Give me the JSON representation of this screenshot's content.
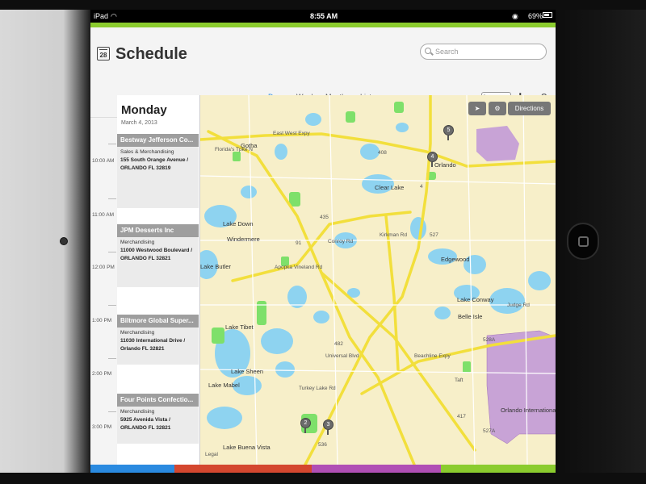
{
  "status_bar": {
    "device": "iPad",
    "time": "8:55 AM",
    "battery": "69%"
  },
  "header": {
    "app_title": "Schedule",
    "calendar_day": "28",
    "search_placeholder": "Search",
    "today_label": "Today",
    "add_label": "+",
    "help_label": "?"
  },
  "tabs": [
    {
      "label": "Day",
      "active": true
    },
    {
      "label": "Week",
      "active": false
    },
    {
      "label": "Month",
      "active": false
    },
    {
      "label": "List",
      "active": false
    }
  ],
  "day_view": {
    "day_name": "Monday",
    "date": "March 4, 2013",
    "time_labels": [
      "10:00 AM",
      "11:00 AM",
      "12:00 PM",
      "1:00 PM",
      "2:00 PM",
      "3:00 PM"
    ],
    "events": [
      {
        "name": "Bestway Jefferson Co...",
        "category": "Sales & Merchandising",
        "address": "155 South Orange Avenue / ORLANDO FL 32819"
      },
      {
        "name": "JPM Desserts Inc",
        "category": "Merchandising",
        "address": "11000 Westwood Boulevard / ORLANDO FL 32821"
      },
      {
        "name": "Biltmore Global Super...",
        "category": "Merchandising",
        "address": "11030 International Drive / Orlando FL 32821"
      },
      {
        "name": "Four Points Confectio...",
        "category": "Merchandising",
        "address": "5925 Avenida Vista / ORLANDO FL 32821"
      }
    ]
  },
  "map": {
    "directions_label": "Directions",
    "place_labels": [
      "Gotha",
      "Orlando",
      "Clear Lake",
      "Lake Down",
      "Windermere",
      "Edgewood",
      "Lake Conway",
      "Judge Rd",
      "Belle Isle",
      "Lake Tibet",
      "Lake Sheen",
      "Lake Mabel",
      "Lake Butler",
      "Universal Blvd",
      "Beachline Expy",
      "Orlando International Airport",
      "Lake Buena Vista",
      "East West Expy",
      "Florida's Tpke N",
      "Conroy Rd",
      "Kirkman Rd",
      "Turkey Lake Rd",
      "Apopka Vineland Rd",
      "Taft",
      "Legal"
    ],
    "road_shields": [
      "408",
      "435",
      "91",
      "527",
      "482",
      "528A",
      "527A",
      "536",
      "417",
      "4"
    ],
    "pins": [
      "5",
      "4",
      "2",
      "3"
    ]
  },
  "bottom_color_bar": [
    "#2a8ae0",
    "#8bcc2e",
    "#d4472f",
    "#b04fb5",
    "#8bcc2e"
  ]
}
